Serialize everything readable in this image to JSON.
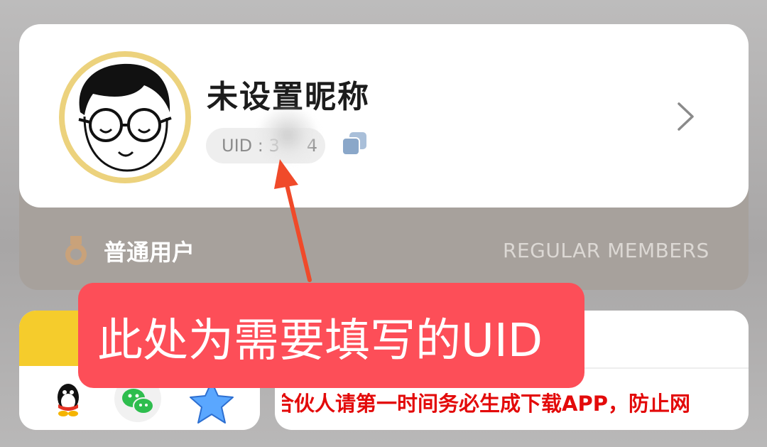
{
  "profile": {
    "nickname": "未设置昵称",
    "uid_label": "UID : ",
    "uid_value": "3",
    "uid_value_tail": "4"
  },
  "membership": {
    "level": "普通用户",
    "tag": "REGULAR MEMBERS"
  },
  "share": {
    "icons": [
      "qq-icon",
      "wechat-icon",
      "favorite-star-icon"
    ]
  },
  "notice": {
    "text": "合伙人请第一时间务必生成下载APP，防止网"
  },
  "annotation": {
    "text": "此处为需要填写的UID"
  },
  "colors": {
    "accent_red": "#fd4e58",
    "notice_red": "#e30a0a",
    "avatar_ring": "#ecd27d",
    "share_yellow": "#f5cc2c"
  }
}
